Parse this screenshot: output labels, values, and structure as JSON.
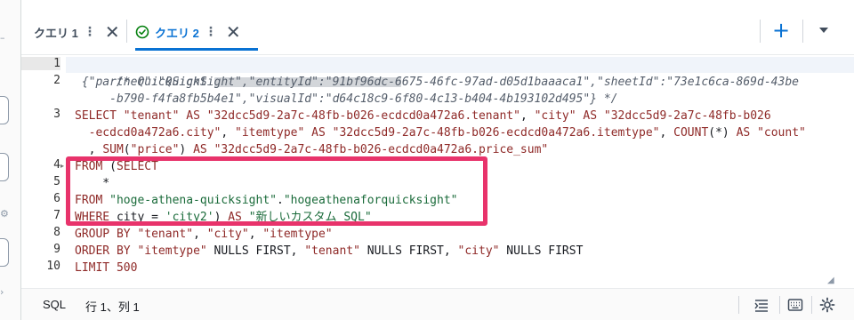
{
  "tabs": [
    {
      "label": "クエリ 1",
      "active": false
    },
    {
      "label": "クエリ 2",
      "active": true
    }
  ],
  "editor": {
    "lines": [
      {
        "no": "1",
        "active": true
      },
      {
        "no": "2"
      },
      {
        "no": "3"
      },
      {
        "no": "4",
        "fold": true
      },
      {
        "no": "5"
      },
      {
        "no": "6"
      },
      {
        "no": "7"
      },
      {
        "no": "8"
      },
      {
        "no": "9"
      },
      {
        "no": "10"
      }
    ],
    "code": {
      "l1_comment": "/* QuickSight ",
      "l2a": " {\"partner\":\"QuickSight\",\"entityId\":\"91bf96dc-6675-46fc-97ad-d05d1baaaca1\",\"sheetId\":\"73e1c6ca-869d-43be",
      "l2b": "     -b790-f4fa8fb5b4e1\",\"visualId\":\"d64c18c9-6f80-4c13-b404-4b193102d495\"} */",
      "l3a_kw1": "SELECT ",
      "l3a_s1": "\"tenant\"",
      "l3a_kw2": " AS ",
      "l3a_s2": "\"32dcc5d9-2a7c-48fb-b026-ecdcd0a472a6.tenant\"",
      "l3a_t1": ", ",
      "l3a_s3": "\"city\"",
      "l3a_kw3": " AS ",
      "l3a_s4": "\"32dcc5d9-2a7c-48fb-b026",
      "l3b_s1": "  -ecdcd0a472a6.city\"",
      "l3b_t1": ", ",
      "l3b_s2": "\"itemtype\"",
      "l3b_kw1": " AS ",
      "l3b_s3": "\"32dcc5d9-2a7c-48fb-b026-ecdcd0a472a6.itemtype\"",
      "l3b_t2": ", ",
      "l3b_kw2": "COUNT",
      "l3b_t3": "(*)",
      "l3b_kw3": " AS ",
      "l3b_s4": "\"count\"",
      "l3c_t1": "  , ",
      "l3c_kw1": "SUM",
      "l3c_t2": "(",
      "l3c_s1": "\"price\"",
      "l3c_t3": ")",
      "l3c_kw2": " AS ",
      "l3c_s2": "\"32dcc5d9-2a7c-48fb-b026-ecdcd0a472a6.price_sum\"",
      "l4_kw1": "FROM ",
      "l4_t1": "(",
      "l4_kw2": "SELECT",
      "l5_t1": "    *",
      "l6_kw1": "FROM ",
      "l6_s1": "\"hoge-athena-quicksight\"",
      "l6_t1": ".",
      "l6_s2": "\"hogeathenaforquicksight\"",
      "l7_kw1": "WHERE ",
      "l7_t1": "city = ",
      "l7_s1": "'city2'",
      "l7_t2": ")",
      "l7_kw2": " AS ",
      "l7_s2": "\"新しいカスタム SQL\"",
      "l8_kw1": "GROUP BY ",
      "l8_s1": "\"tenant\"",
      "l8_t1": ", ",
      "l8_s2": "\"city\"",
      "l8_t2": ", ",
      "l8_s3": "\"itemtype\"",
      "l9_kw1": "ORDER BY ",
      "l9_s1": "\"itemtype\"",
      "l9_kw2": " NULLS FIRST",
      "l9_t1": ", ",
      "l9_s2": "\"tenant\"",
      "l9_kw3": " NULLS FIRST",
      "l9_t2": ", ",
      "l9_s3": "\"city\"",
      "l9_kw4": " NULLS FIRST",
      "l10_kw1": "LIMIT ",
      "l10_t1": "500"
    }
  },
  "statusbar": {
    "language": "SQL",
    "position": "行 1、列 1"
  },
  "icons": {
    "add": "plus-icon",
    "menu": "caret-down-icon",
    "check": "check-circle-icon",
    "format": "format-icon",
    "keyboard": "keyboard-icon",
    "settings": "gear-icon"
  },
  "colors": {
    "accent": "#0972d3",
    "highlight": "#e8336b",
    "keyword": "#8f2a28",
    "string": "#1a6b3a"
  }
}
